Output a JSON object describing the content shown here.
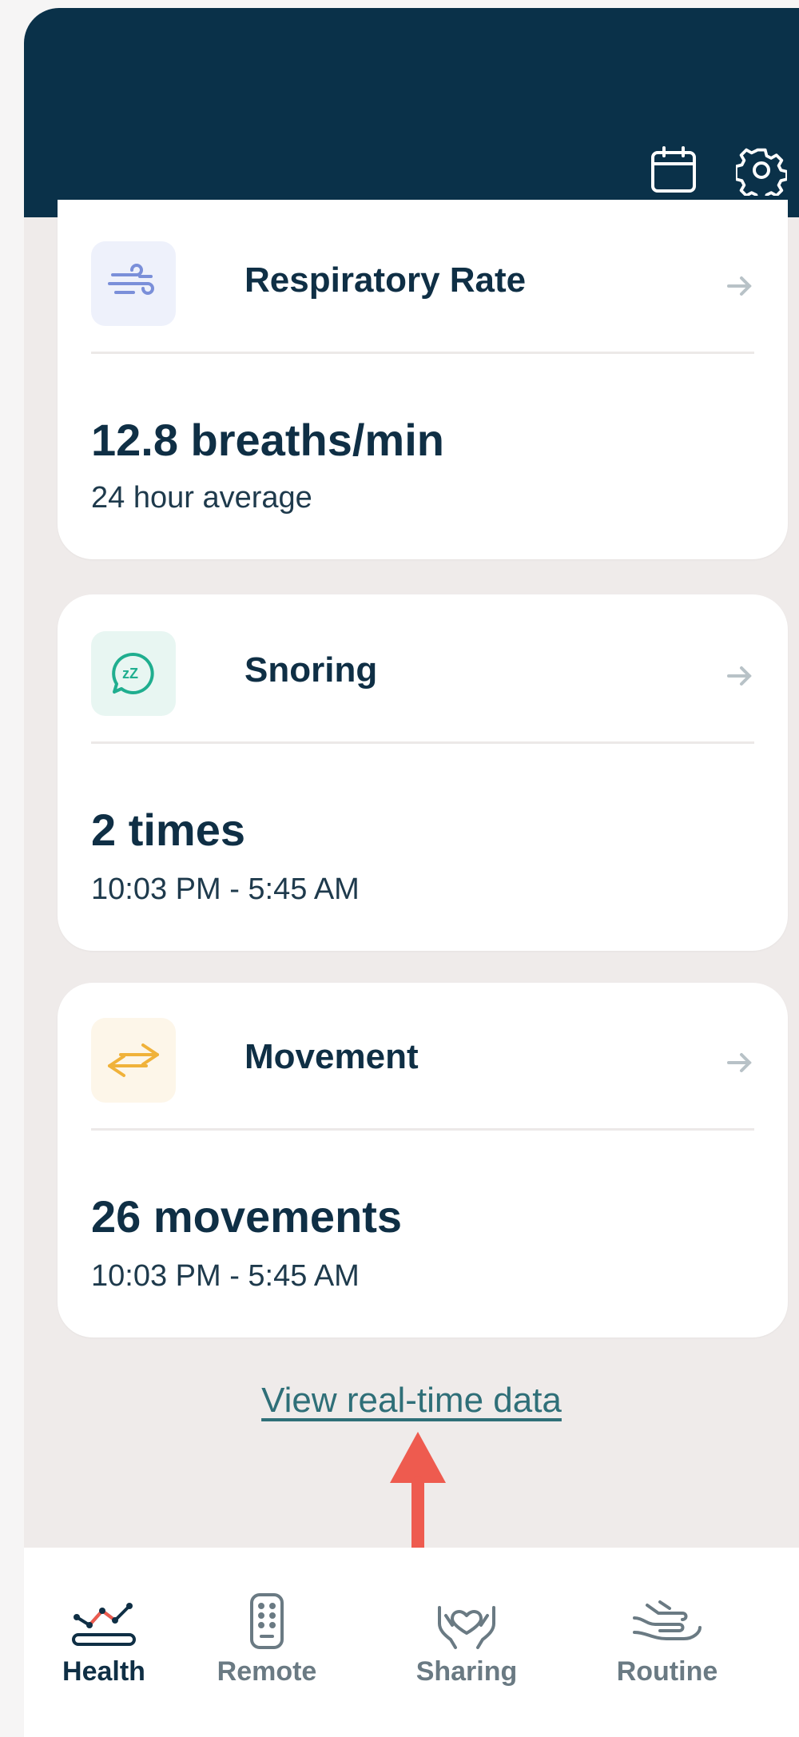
{
  "cards": [
    {
      "title": "Respiratory Rate",
      "value": "12.8 breaths/min",
      "subtitle": "24 hour average",
      "icon": "wind-icon"
    },
    {
      "title": "Snoring",
      "value": "2 times",
      "subtitle": "10:03 PM - 5:45 AM",
      "icon": "snore-bubble-icon"
    },
    {
      "title": "Movement",
      "value": "26 movements",
      "subtitle": "10:03 PM - 5:45 AM",
      "icon": "movement-arrows-icon"
    }
  ],
  "link_text": "View real-time data",
  "tabs": [
    {
      "label": "Health",
      "icon": "health-chart-icon",
      "active": true
    },
    {
      "label": "Remote",
      "icon": "remote-icon",
      "active": false
    },
    {
      "label": "Sharing",
      "icon": "sharing-hands-heart-icon",
      "active": false
    },
    {
      "label": "Routine",
      "icon": "routine-hand-icon",
      "active": false
    }
  ],
  "header_icons": [
    "calendar-icon",
    "gear-icon"
  ],
  "colors": {
    "header": "#0a3149",
    "accent_arrow": "#ee5b4f",
    "link": "#2f6f78"
  }
}
